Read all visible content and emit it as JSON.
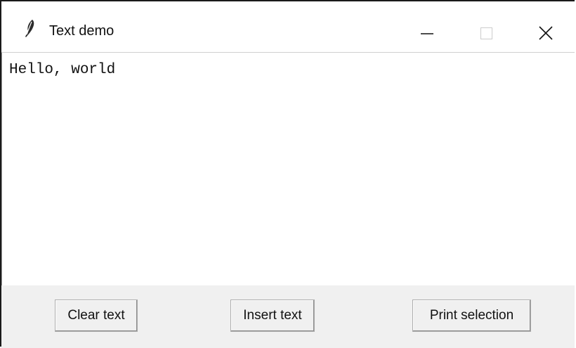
{
  "window": {
    "title": "Text demo",
    "icon": "feather-icon",
    "controls": [
      "minimize-icon",
      "maximize-icon",
      "close-icon"
    ]
  },
  "text_widget": {
    "content": "Hello, world"
  },
  "buttons": {
    "clear_label": "Clear text",
    "insert_label": "Insert text",
    "print_label": "Print selection"
  },
  "colors": {
    "button_bar_bg": "#f0f0f0",
    "text_bg": "#ffffff",
    "window_border": "#1a1a1a"
  }
}
